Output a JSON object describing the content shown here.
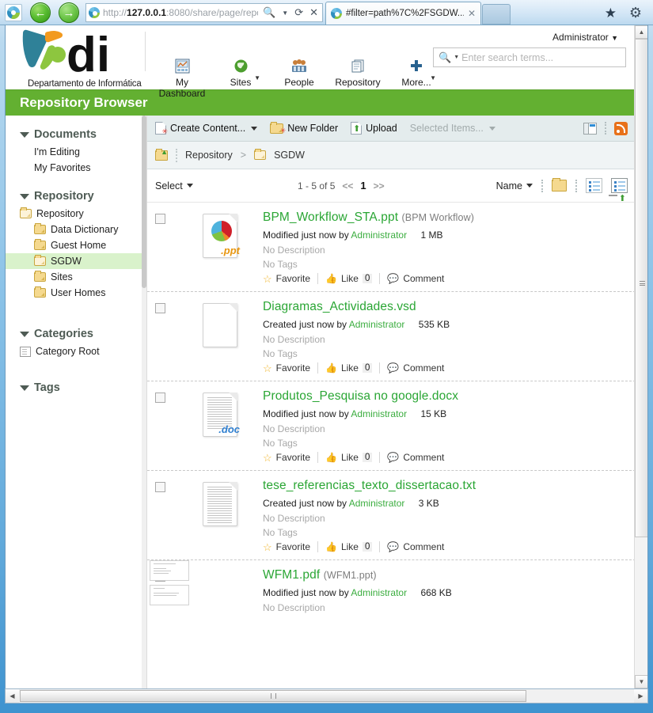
{
  "browser": {
    "back_label": "Back",
    "forward_label": "Forward",
    "url_prefix": "http://",
    "url_host": "127.0.0.1",
    "url_rest": ":8080/share/page/repo:",
    "search_glyph": "search-icon",
    "refresh_glyph": "refresh-icon",
    "stop_glyph": "stop-icon",
    "tab_title": "#filter=path%7C%2FSGDW...",
    "tab_close": "✕",
    "favorites_icon": "star-icon",
    "settings_icon": "gear-icon"
  },
  "header": {
    "logo_caption": "Departamento de Informática",
    "user_menu": "Administrator",
    "nav": [
      {
        "label": "My Dashboard",
        "icon": "dashboard-icon",
        "caret": false
      },
      {
        "label": "Sites",
        "icon": "globe-icon",
        "caret": true
      },
      {
        "label": "People",
        "icon": "people-icon",
        "caret": false
      },
      {
        "label": "Repository",
        "icon": "repository-icon",
        "caret": false
      },
      {
        "label": "More...",
        "icon": "plus-icon",
        "caret": true
      }
    ],
    "search_placeholder": "Enter search terms..."
  },
  "title_band": {
    "title": "Repository Browser"
  },
  "sidebar": {
    "documents": {
      "header": "Documents",
      "links": [
        "I'm Editing",
        "My Favorites"
      ]
    },
    "repository": {
      "header": "Repository",
      "root": "Repository",
      "children": [
        "Data Dictionary",
        "Guest Home",
        "SGDW",
        "Sites",
        "User Homes"
      ],
      "active": "SGDW"
    },
    "categories": {
      "header": "Categories",
      "root": "Category Root"
    },
    "tags": {
      "header": "Tags"
    }
  },
  "toolbar": {
    "create_content": "Create Content...",
    "new_folder": "New Folder",
    "upload": "Upload",
    "selected_items": "Selected Items...",
    "pane_toggle": "pane-toggle-icon",
    "rss": "rss-icon"
  },
  "breadcrumb": {
    "up_icon": "folder-up-icon",
    "root": "Repository",
    "separator": ">",
    "current": "SGDW"
  },
  "options": {
    "select": "Select",
    "pager_range": "1 - 5 of 5",
    "pager_first": "<<",
    "pager_page": "1",
    "pager_next": ">>",
    "sort_label": "Name",
    "folder_toggle": "show-folders-icon",
    "view_simple": "simple-view-icon",
    "view_detailed": "detailed-view-icon",
    "sort_direction": "sort-ascending-icon"
  },
  "labels": {
    "no_description": "No Description",
    "no_tags": "No Tags",
    "favorite": "Favorite",
    "like": "Like",
    "comment": "Comment"
  },
  "documents": [
    {
      "name": "BPM_Workflow_STA.ppt",
      "alt_name": "(BPM Workflow)",
      "meta_action": "Modified just now by",
      "author": "Administrator",
      "size": "1 MB",
      "description": "No Description",
      "tags": "No Tags",
      "favorite": "Favorite",
      "like": "Like",
      "like_count": "0",
      "comment": "Comment",
      "thumb_type": "ppt",
      "thumb_ext": ".ppt"
    },
    {
      "name": "Diagramas_Actividades.vsd",
      "alt_name": "",
      "meta_action": "Created just now by",
      "author": "Administrator",
      "size": "535 KB",
      "description": "No Description",
      "tags": "No Tags",
      "favorite": "Favorite",
      "like": "Like",
      "like_count": "0",
      "comment": "Comment",
      "thumb_type": "generic",
      "thumb_ext": ""
    },
    {
      "name": "Produtos_Pesquisa no google.docx",
      "alt_name": "",
      "meta_action": "Modified just now by",
      "author": "Administrator",
      "size": "15 KB",
      "description": "No Description",
      "tags": "No Tags",
      "favorite": "Favorite",
      "like": "Like",
      "like_count": "0",
      "comment": "Comment",
      "thumb_type": "doc",
      "thumb_ext": ".doc"
    },
    {
      "name": "tese_referencias_texto_dissertacao.txt",
      "alt_name": "",
      "meta_action": "Created just now by",
      "author": "Administrator",
      "size": "3 KB",
      "description": "No Description",
      "tags": "No Tags",
      "favorite": "Favorite",
      "like": "Like",
      "like_count": "0",
      "comment": "Comment",
      "thumb_type": "text",
      "thumb_ext": ""
    },
    {
      "name": "WFM1.pdf",
      "alt_name": "(WFM1.ppt)",
      "meta_action": "Modified just now by",
      "author": "Administrator",
      "size": "668 KB",
      "description": "No Description",
      "tags": "",
      "favorite": "",
      "like": "",
      "like_count": "",
      "comment": "",
      "thumb_type": "slides",
      "thumb_ext": ""
    }
  ],
  "colors": {
    "brand_green": "#63b031",
    "link_green": "#2aa634",
    "sidebar_active": "#d9f2cb",
    "toolbar_bg": "#e4eced",
    "rss_orange": "#e8711a"
  }
}
